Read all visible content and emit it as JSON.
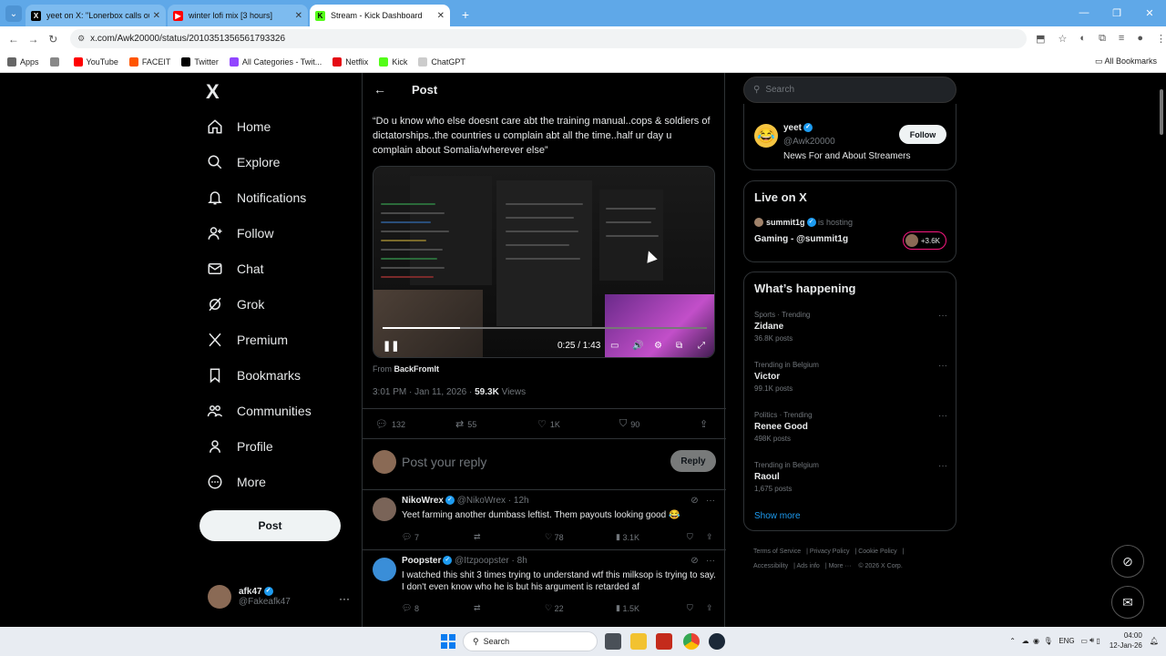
{
  "browser": {
    "tabs": [
      {
        "label": "yeet on X: \"Lonerbox calls out A",
        "favicon": "X",
        "color": "#000000"
      },
      {
        "label": "winter lofi mix [3 hours]",
        "favicon": "YT",
        "color": "#ff0000"
      },
      {
        "label": "Stream - Kick Dashboard",
        "favicon": "K",
        "color": "#53fc18"
      }
    ],
    "new_tab": "+",
    "url": "x.com/Awk20000/status/2010351356561793326",
    "bookmarks": [
      "Apps",
      "YouTube",
      "FACEIT",
      "Twitter",
      "All Categories - Twit...",
      "Netflix",
      "Kick",
      "ChatGPT"
    ],
    "all_bookmarks": "All Bookmarks"
  },
  "nav": {
    "logo": "X",
    "items": [
      {
        "label": "Home",
        "icon": "home-icon"
      },
      {
        "label": "Explore",
        "icon": "search-icon"
      },
      {
        "label": "Notifications",
        "icon": "bell-icon"
      },
      {
        "label": "Follow",
        "icon": "person-add-icon"
      },
      {
        "label": "Chat",
        "icon": "mail-icon"
      },
      {
        "label": "Grok",
        "icon": "grok-icon"
      },
      {
        "label": "Premium",
        "icon": "x-icon"
      },
      {
        "label": "Bookmarks",
        "icon": "bookmark-icon"
      },
      {
        "label": "Communities",
        "icon": "people-icon"
      },
      {
        "label": "Profile",
        "icon": "person-icon"
      },
      {
        "label": "More",
        "icon": "more-circle-icon"
      }
    ],
    "post_button": "Post",
    "user": {
      "name": "afk47",
      "handle": "@Fakeafk47"
    }
  },
  "post": {
    "header": "Post",
    "text": "“Do u know who else doesnt care abt the training manual..cops & soldiers of dictatorships..the countries u complain abt all the time..half ur day u complain about Somalia/wherever else”",
    "video": {
      "time": "0:25 / 1:43",
      "progress": 0.24
    },
    "from_label": "From",
    "from_account": "BackFromIt",
    "timestamp": "3:01 PM · Jan 11, 2026 · ",
    "views_count": "59.3K",
    "views_label": " Views",
    "stats": {
      "replies": "132",
      "reposts": "55",
      "likes": "1K",
      "bookmarks": "90"
    },
    "reply_placeholder": "Post your reply",
    "reply_button": "Reply"
  },
  "replies": [
    {
      "name": "NikoWrex",
      "handle": "@NikoWrex · 12h",
      "text": "Yeet farming another dumbass leftist. Them payouts looking good 😂",
      "replies": "7",
      "reposts": "",
      "likes": "78",
      "views": "3.1K"
    },
    {
      "name": "Poopster",
      "handle": "@Itzpoopster · 8h",
      "text": "I watched this shit 3 times trying to understand wtf this milksop is trying to say. I don't even know who he is but his argument is retarded af",
      "replies": "8",
      "reposts": "",
      "likes": "22",
      "views": "1.5K"
    }
  ],
  "right": {
    "search_placeholder": "Search",
    "who_to_follow": {
      "name": "yeet",
      "handle": "@Awk20000",
      "bio": "News For and About Streamers",
      "button": "Follow"
    },
    "live": {
      "title": "Live on X",
      "host": "summit1g",
      "hosting": "is hosting",
      "stream": "Gaming - @summit1g",
      "count": "+3.6K"
    },
    "happening": {
      "title": "What’s happening",
      "trends": [
        {
          "category": "Sports · Trending",
          "name": "Zidane",
          "posts": "36.8K posts"
        },
        {
          "category": "Trending in Belgium",
          "name": "Victor",
          "posts": "99.1K posts"
        },
        {
          "category": "Politics · Trending",
          "name": "Renee Good",
          "posts": "498K posts"
        },
        {
          "category": "Trending in Belgium",
          "name": "Raoul",
          "posts": "1,675 posts"
        }
      ],
      "show_more": "Show more"
    },
    "footer": [
      "Terms of Service",
      "Privacy Policy",
      "Cookie Policy",
      "Accessibility",
      "Ads info",
      "More ···",
      "© 2026 X Corp."
    ]
  },
  "taskbar": {
    "search": "Search",
    "lang": "ENG",
    "time": "04:00",
    "date": "12-Jan-26"
  }
}
